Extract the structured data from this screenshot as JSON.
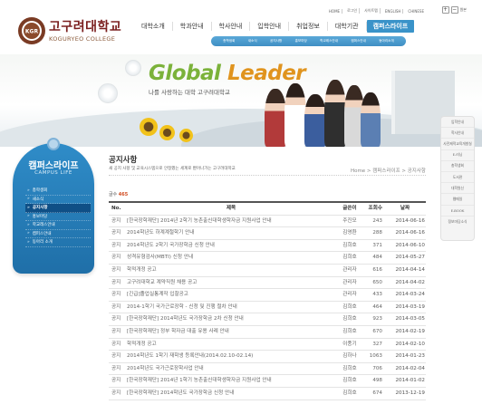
{
  "header": {
    "logo_kr": "고구려대학교",
    "logo_en": "KOGURYEO COLLEGE",
    "emblem_text": "KGR",
    "top_links": [
      "HOME",
      "로그인",
      "사이트맵",
      "ENGLISH",
      "CHINESE"
    ],
    "zoom_label": "원본",
    "nav": [
      "대학소개",
      "학과안내",
      "학사안내",
      "입학안내",
      "취업정보",
      "대학기관",
      "캠퍼스라이프"
    ],
    "active_nav": "캠퍼스라이프",
    "subnav": [
      "총학생회",
      "새소식",
      "공지사항",
      "홍보마당",
      "학교레스안내",
      "캠퍼스안내",
      "동아리소개"
    ]
  },
  "banner": {
    "title_part1": "Global",
    "title_part2": "Leader",
    "subtitle": "나를 사랑하는 대학 고구려대학교"
  },
  "sidebar": {
    "title": "캠퍼스라이프",
    "subtitle": "CAMPUS LIFE",
    "items": [
      "총학생회",
      "새소식",
      "공지사항",
      "홍보마당",
      "학교레스안내",
      "캠퍼스안내",
      "동아리 소개"
    ],
    "active": "공지사항"
  },
  "content": {
    "title": "공지사항",
    "description": "새 공지 사항 및 교육시스템으로 안정했는 세계로 뻗어나가는 고구려대학교",
    "breadcrumb": "Home > 캠퍼스라이프 > 공지사항",
    "count_label": "글수",
    "count_value": "465",
    "columns": {
      "no": "No.",
      "title": "제목",
      "author": "글쓴이",
      "views": "조회수",
      "date": "날짜"
    },
    "rows": [
      {
        "no": "공지",
        "title": "[한국장학재단] 2014년 2학기 농촌출신대학생학자금 지원사업 안내",
        "author": "주진모",
        "views": "243",
        "date": "2014-06-16"
      },
      {
        "no": "공지",
        "title": "2014학년도 하계계절학기 안내",
        "author": "김영환",
        "views": "288",
        "date": "2014-06-16"
      },
      {
        "no": "공지",
        "title": "2014학년도 2학기 국가장학금 신청 안내",
        "author": "김희호",
        "views": "371",
        "date": "2014-06-10"
      },
      {
        "no": "공지",
        "title": "성격유형검사(MBTI) 신청 안내",
        "author": "김희호",
        "views": "484",
        "date": "2014-05-27"
      },
      {
        "no": "공지",
        "title": "학적개정 공고",
        "author": "관리자",
        "views": "616",
        "date": "2014-04-14"
      },
      {
        "no": "공지",
        "title": "고구려대학교 계약직원 채용 공고",
        "author": "관리자",
        "views": "650",
        "date": "2014-04-02"
      },
      {
        "no": "공지",
        "title": "[긴급]졸업실통계작 입찰공고",
        "author": "관리자",
        "views": "433",
        "date": "2014-03-24"
      },
      {
        "no": "공지",
        "title": "2014-1학기 국가근로장학 - 신청 및 진행 절차 안내",
        "author": "김희호",
        "views": "464",
        "date": "2014-03-19"
      },
      {
        "no": "공지",
        "title": "[한국장학재단] 2014학년도 국가장학금 2차 신청 안내",
        "author": "김희호",
        "views": "923",
        "date": "2014-03-05"
      },
      {
        "no": "공지",
        "title": "[한국장학재단] 정부 학자금 대출 유용 사례 안내",
        "author": "김희호",
        "views": "670",
        "date": "2014-02-19"
      },
      {
        "no": "공지",
        "title": "학적개정 공고",
        "author": "이풍기",
        "views": "327",
        "date": "2014-02-10"
      },
      {
        "no": "공지",
        "title": "2014학년도 1학기 재학생 등록안내(2014.02.10-02.14)",
        "author": "김하나",
        "views": "1063",
        "date": "2014-01-23"
      },
      {
        "no": "공지",
        "title": "2014학년도 국가근로장학사업 안내",
        "author": "김희호",
        "views": "706",
        "date": "2014-02-04"
      },
      {
        "no": "공지",
        "title": "[한국장학재단] 2014년 1학기 농촌출신대학생학자금 지원사업 안내",
        "author": "김희호",
        "views": "498",
        "date": "2014-01-02"
      },
      {
        "no": "공지",
        "title": "[한국장학재단] 2014학년도 국가장학금 신청 안내",
        "author": "김희호",
        "views": "674",
        "date": "2013-12-19"
      }
    ]
  },
  "quick_links": [
    "입학안내",
    "학사안내",
    "사전제적교육개발실",
    "E-러닝",
    "총학생회",
    "도서관",
    "대학원신",
    "웹메일",
    "E-BOOK",
    "정보마당소식"
  ],
  "colors": {
    "accent_blue": "#3a93c9",
    "sidebar_blue": "#2f8cc8",
    "brand_red": "#7a1e1e",
    "count_red": "#d14b1f",
    "global_green": "#7bb23a",
    "leader_orange": "#e0941e"
  }
}
